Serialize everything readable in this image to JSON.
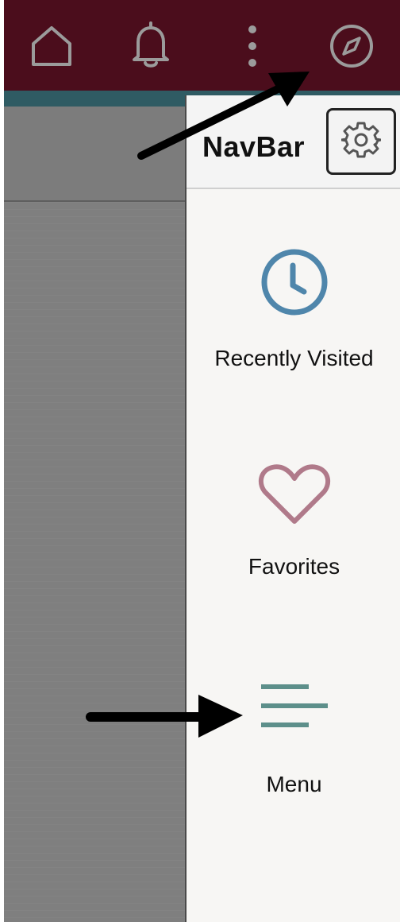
{
  "topbar": {
    "icons": [
      "home-icon",
      "bell-icon",
      "more-vertical-icon",
      "compass-icon"
    ],
    "bg_color": "#4b0d1c",
    "accent_strip_color": "#2f5b63"
  },
  "navbar": {
    "title": "NavBar",
    "settings_icon": "gear-icon",
    "items": [
      {
        "label": "Recently Visited",
        "icon": "clock-icon",
        "color": "#4f86ab"
      },
      {
        "label": "Favorites",
        "icon": "heart-icon",
        "color": "#b07a8a"
      },
      {
        "label": "Menu",
        "icon": "menu-lines-icon",
        "color": "#5d8f8a"
      }
    ]
  },
  "annotations": {
    "arrows": [
      "arrow-to-compass",
      "arrow-to-menu"
    ]
  }
}
